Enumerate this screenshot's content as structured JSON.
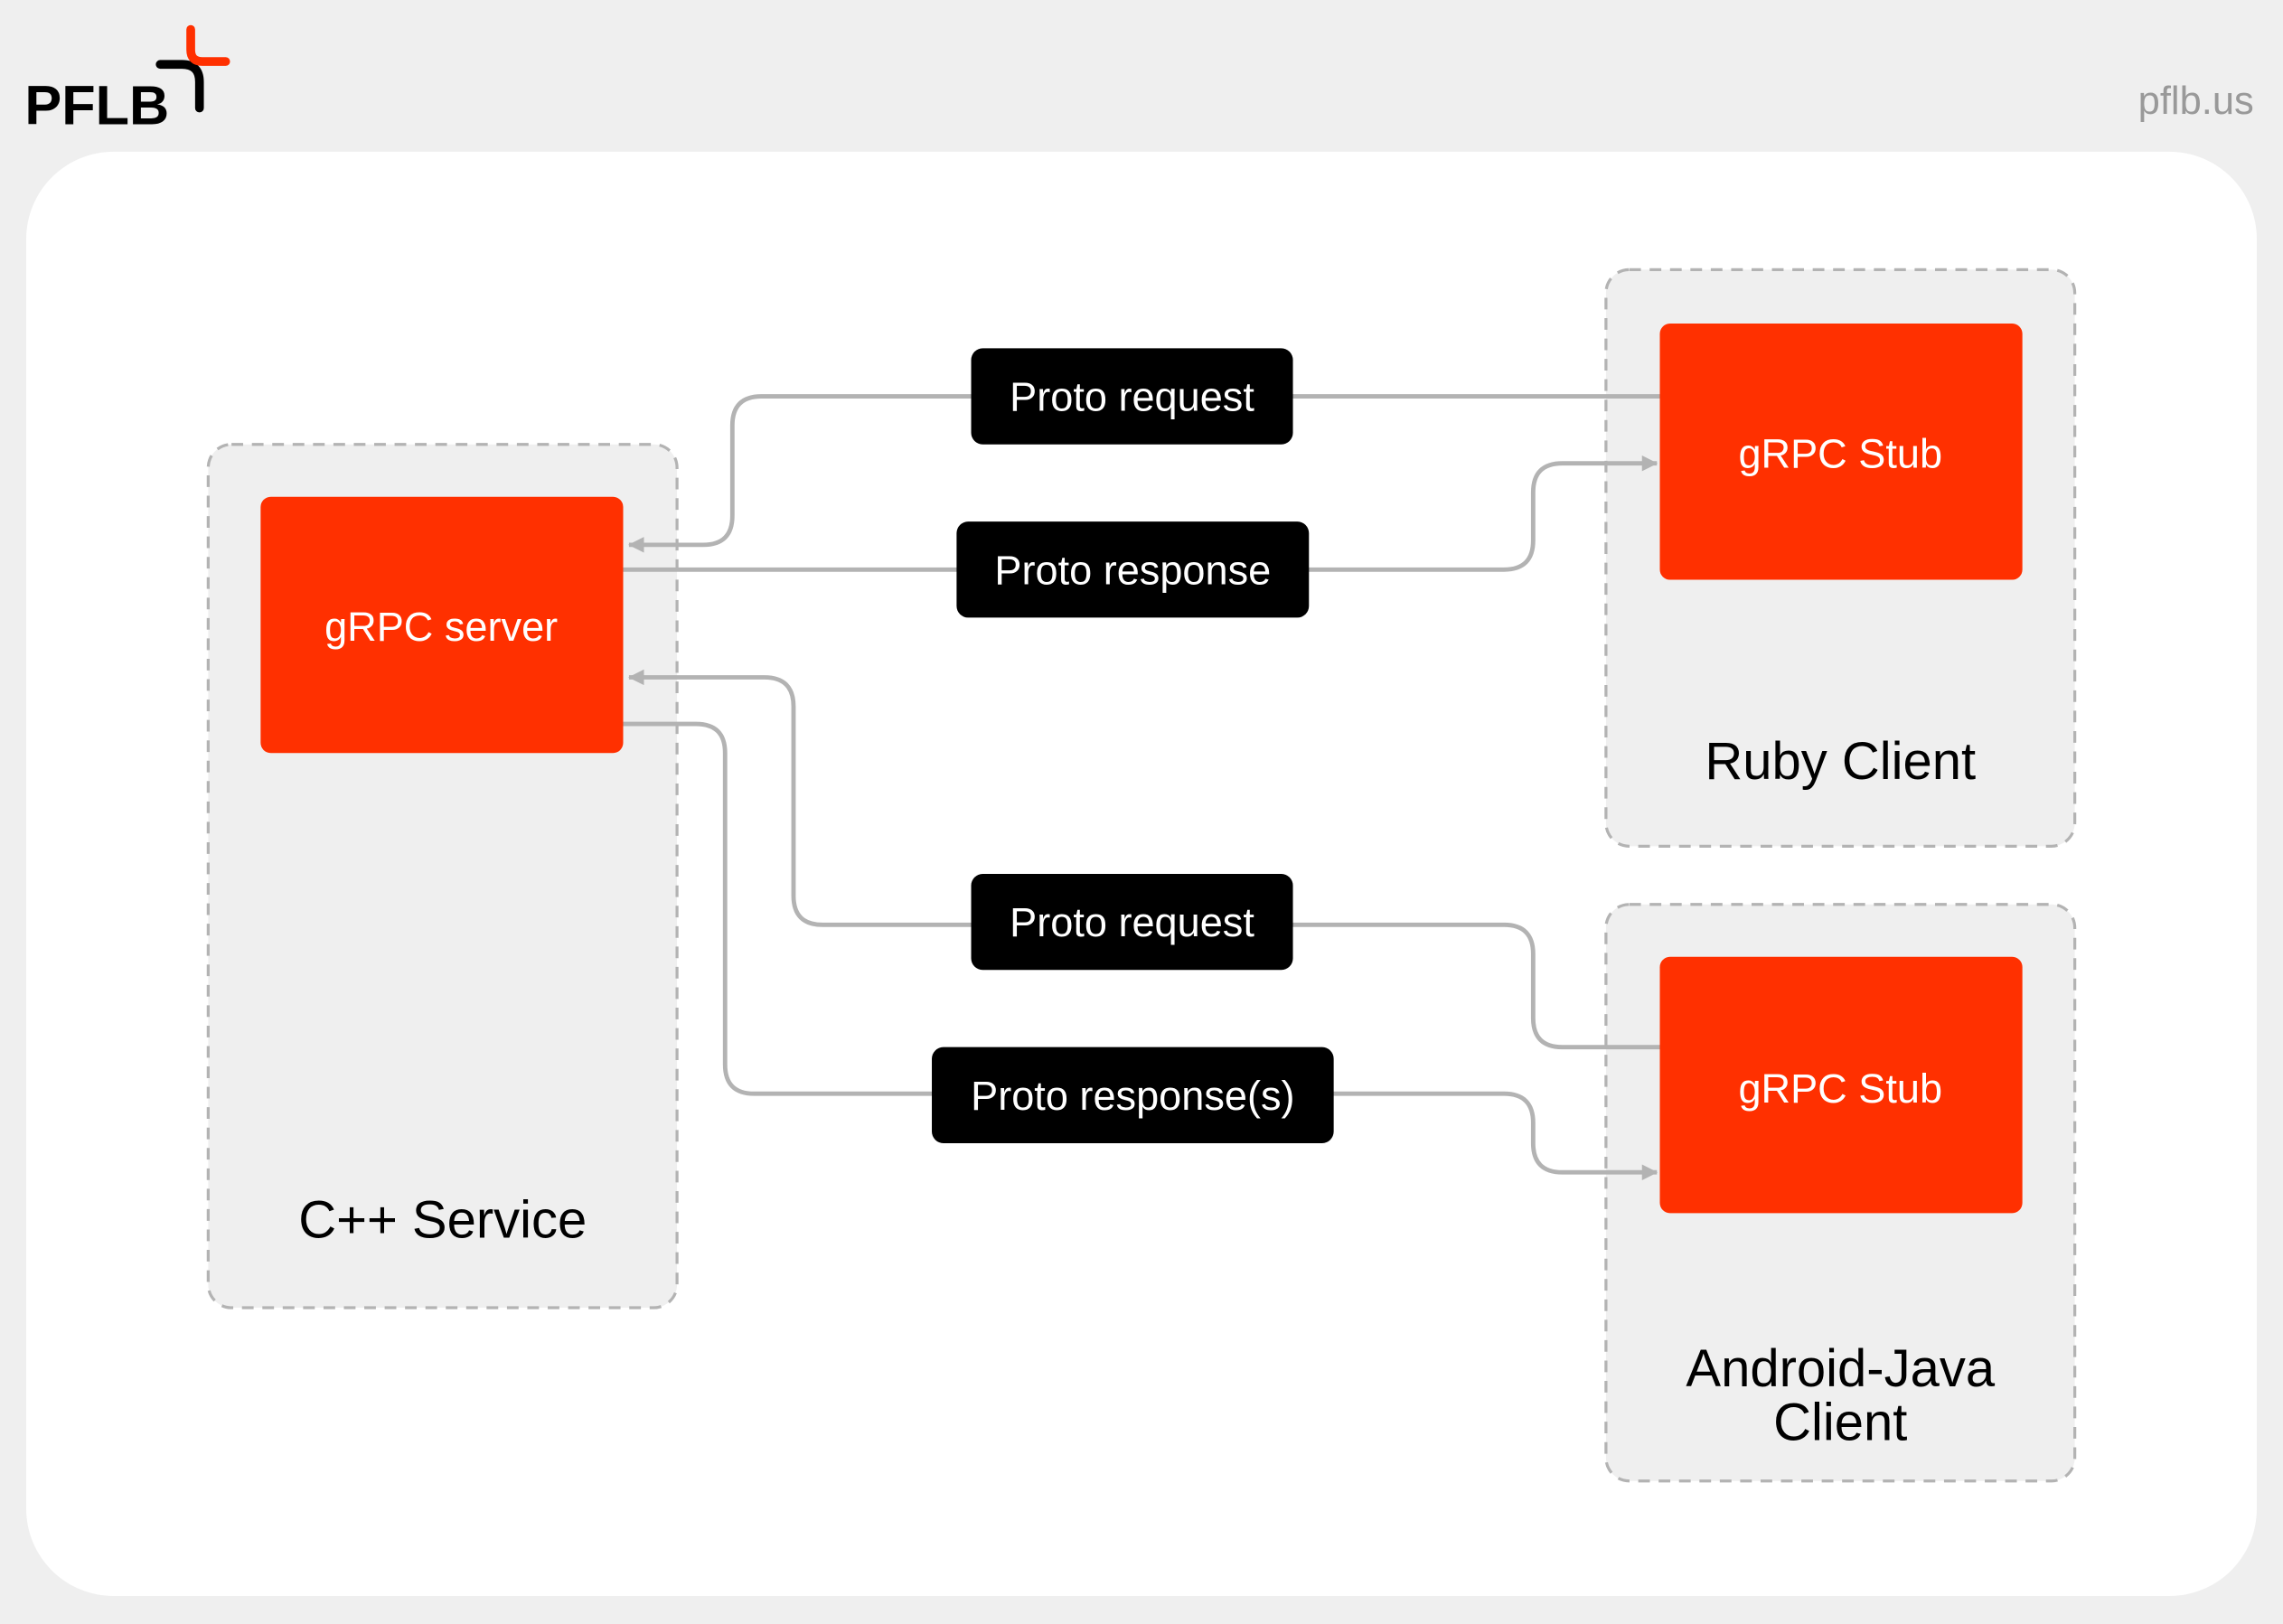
{
  "brand": {
    "logo_text": "PFLB",
    "site": "pflb.us"
  },
  "colors": {
    "accent": "#ff3000",
    "label_bg": "#000000",
    "line": "#b3b3b3",
    "container_bg": "#efefef",
    "card_bg": "#ffffff"
  },
  "nodes": {
    "cpp_service": {
      "title": "C++ Service",
      "component": "gRPC server"
    },
    "ruby_client": {
      "title": "Ruby Client",
      "component": "gRPC Stub"
    },
    "android_client": {
      "title_line1": "Android-Java",
      "title_line2": "Client",
      "component": "gRPC Stub"
    }
  },
  "edges": [
    {
      "label": "Proto request",
      "from": "Ruby Client",
      "to": "C++ Service"
    },
    {
      "label": "Proto response",
      "from": "C++ Service",
      "to": "Ruby Client"
    },
    {
      "label": "Proto request",
      "from": "Android-Java Client",
      "to": "C++ Service"
    },
    {
      "label": "Proto response(s)",
      "from": "C++ Service",
      "to": "Android-Java Client"
    }
  ]
}
